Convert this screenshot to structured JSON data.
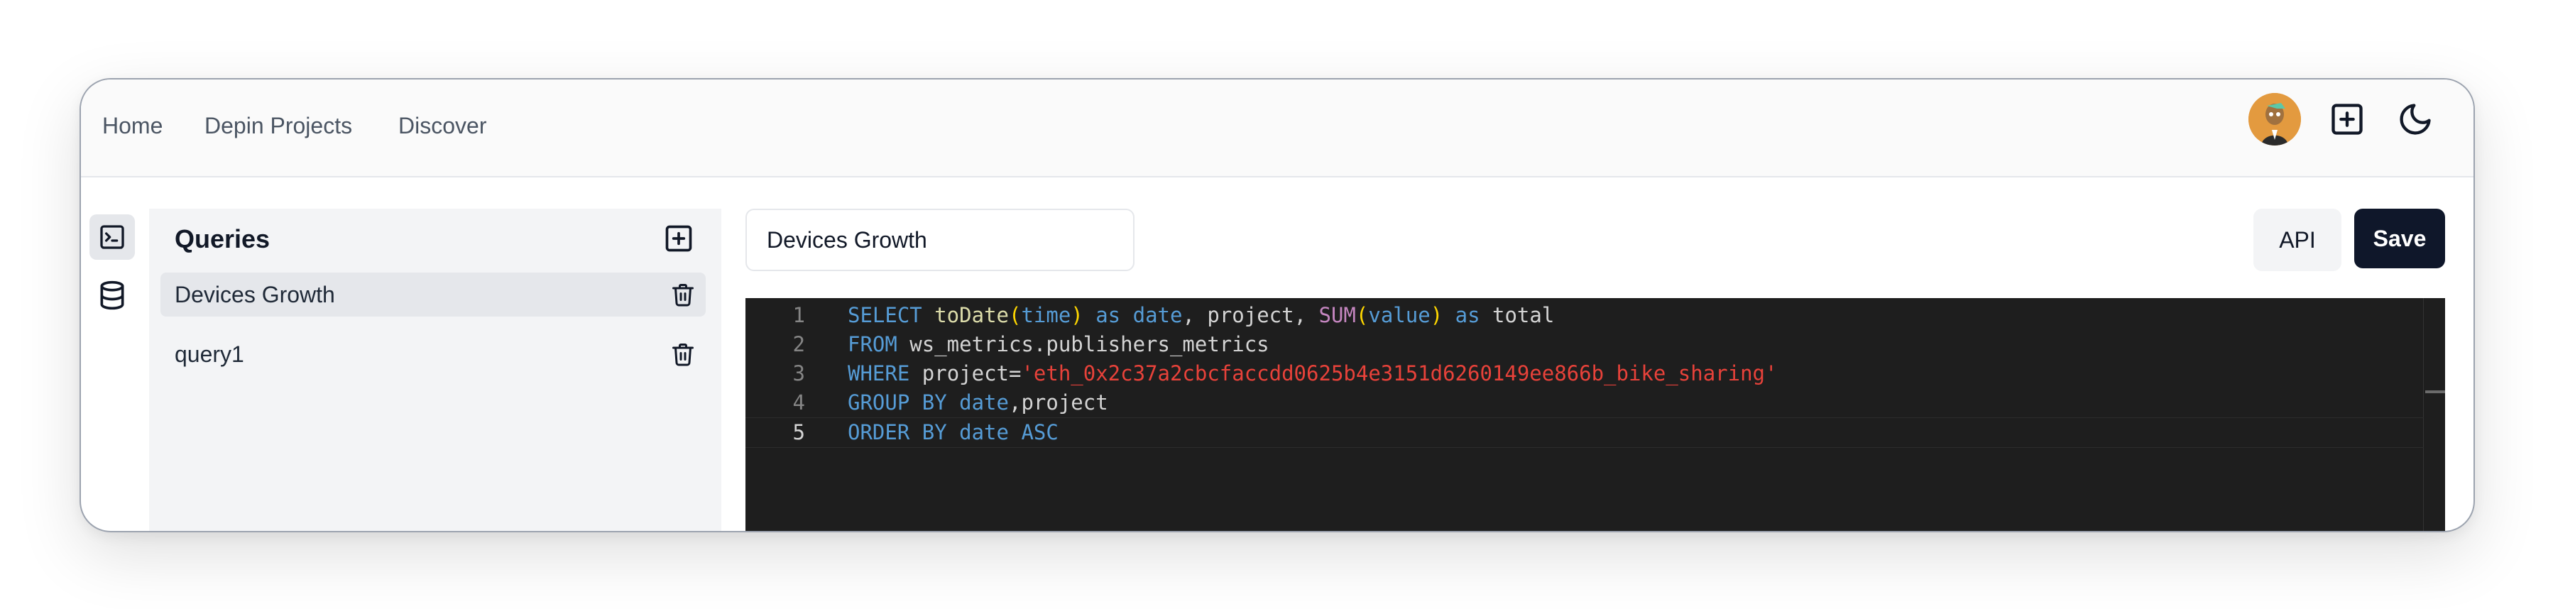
{
  "nav": {
    "links": [
      "Home",
      "Depin Projects",
      "Discover"
    ]
  },
  "header_icons": {
    "avatar": "user-avatar",
    "add": "plus-square-icon",
    "theme": "moon-icon"
  },
  "left_rail": {
    "items": [
      "terminal-icon",
      "database-icon"
    ]
  },
  "sidebar": {
    "title": "Queries",
    "add_icon": "plus-square-icon",
    "items": [
      {
        "label": "Devices Growth",
        "active": true
      },
      {
        "label": "query1",
        "active": false
      }
    ]
  },
  "query_name": {
    "value": "Devices Growth"
  },
  "actions": {
    "api_label": "API",
    "save_label": "Save"
  },
  "editor": {
    "lines": [
      {
        "n": "1",
        "tokens": [
          {
            "t": "SELECT",
            "c": "kw"
          },
          {
            "t": " toDate",
            "c": "fn"
          },
          {
            "t": "(",
            "c": "par"
          },
          {
            "t": "time",
            "c": "kw"
          },
          {
            "t": ")",
            "c": "par"
          },
          {
            "t": " as ",
            "c": "kw"
          },
          {
            "t": "date",
            "c": "kw"
          },
          {
            "t": ", project, ",
            "c": ""
          },
          {
            "t": "SUM",
            "c": "fn2"
          },
          {
            "t": "(",
            "c": "par"
          },
          {
            "t": "value",
            "c": "kw"
          },
          {
            "t": ")",
            "c": "par"
          },
          {
            "t": " as ",
            "c": "kw"
          },
          {
            "t": "total",
            "c": ""
          }
        ]
      },
      {
        "n": "2",
        "tokens": [
          {
            "t": "FROM",
            "c": "kw"
          },
          {
            "t": " ws_metrics.publishers_metrics",
            "c": ""
          }
        ]
      },
      {
        "n": "3",
        "tokens": [
          {
            "t": "WHERE",
            "c": "kw"
          },
          {
            "t": " project=",
            "c": ""
          },
          {
            "t": "'eth_0x2c37a2cbcfaccdd0625b4e3151d6260149ee866b_bike_sharing'",
            "c": "str"
          }
        ]
      },
      {
        "n": "4",
        "tokens": [
          {
            "t": "GROUP BY ",
            "c": "kw"
          },
          {
            "t": "date",
            "c": "kw"
          },
          {
            "t": ",project",
            "c": ""
          }
        ]
      },
      {
        "n": "5",
        "tokens": [
          {
            "t": "ORDER BY ",
            "c": "kw"
          },
          {
            "t": "date",
            "c": "kw"
          },
          {
            "t": " ASC",
            "c": "kw"
          }
        ]
      }
    ],
    "current_line": 5
  },
  "colors": {
    "accent_dark": "#0f172a",
    "editor_bg": "#1e1e1e",
    "keyword": "#569cd6",
    "string": "#e8423a",
    "function": "#c586c0",
    "avatar_bg": "#e39a3f"
  }
}
